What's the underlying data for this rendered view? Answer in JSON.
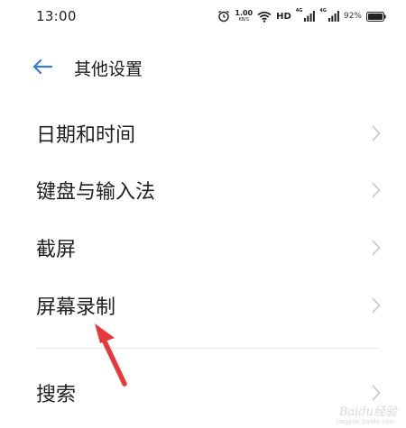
{
  "status_bar": {
    "time": "13:00",
    "speed_value": "1.00",
    "speed_unit": "KB/S",
    "hd_label": "HD",
    "signal1_label": "4G",
    "signal2_label": "4G",
    "battery_percent": "92%"
  },
  "header": {
    "title": "其他设置"
  },
  "settings": {
    "items": [
      {
        "label": "日期和时间"
      },
      {
        "label": "键盘与输入法"
      },
      {
        "label": "截屏"
      },
      {
        "label": "屏幕录制"
      },
      {
        "label": "搜索"
      }
    ]
  },
  "colors": {
    "accent": "#3a7bd5",
    "annotation_arrow": "#e8393a",
    "chevron": "#c4c4c4"
  },
  "watermark": {
    "text": "Baidu经验",
    "sub": "jingyan.baidu.com"
  }
}
